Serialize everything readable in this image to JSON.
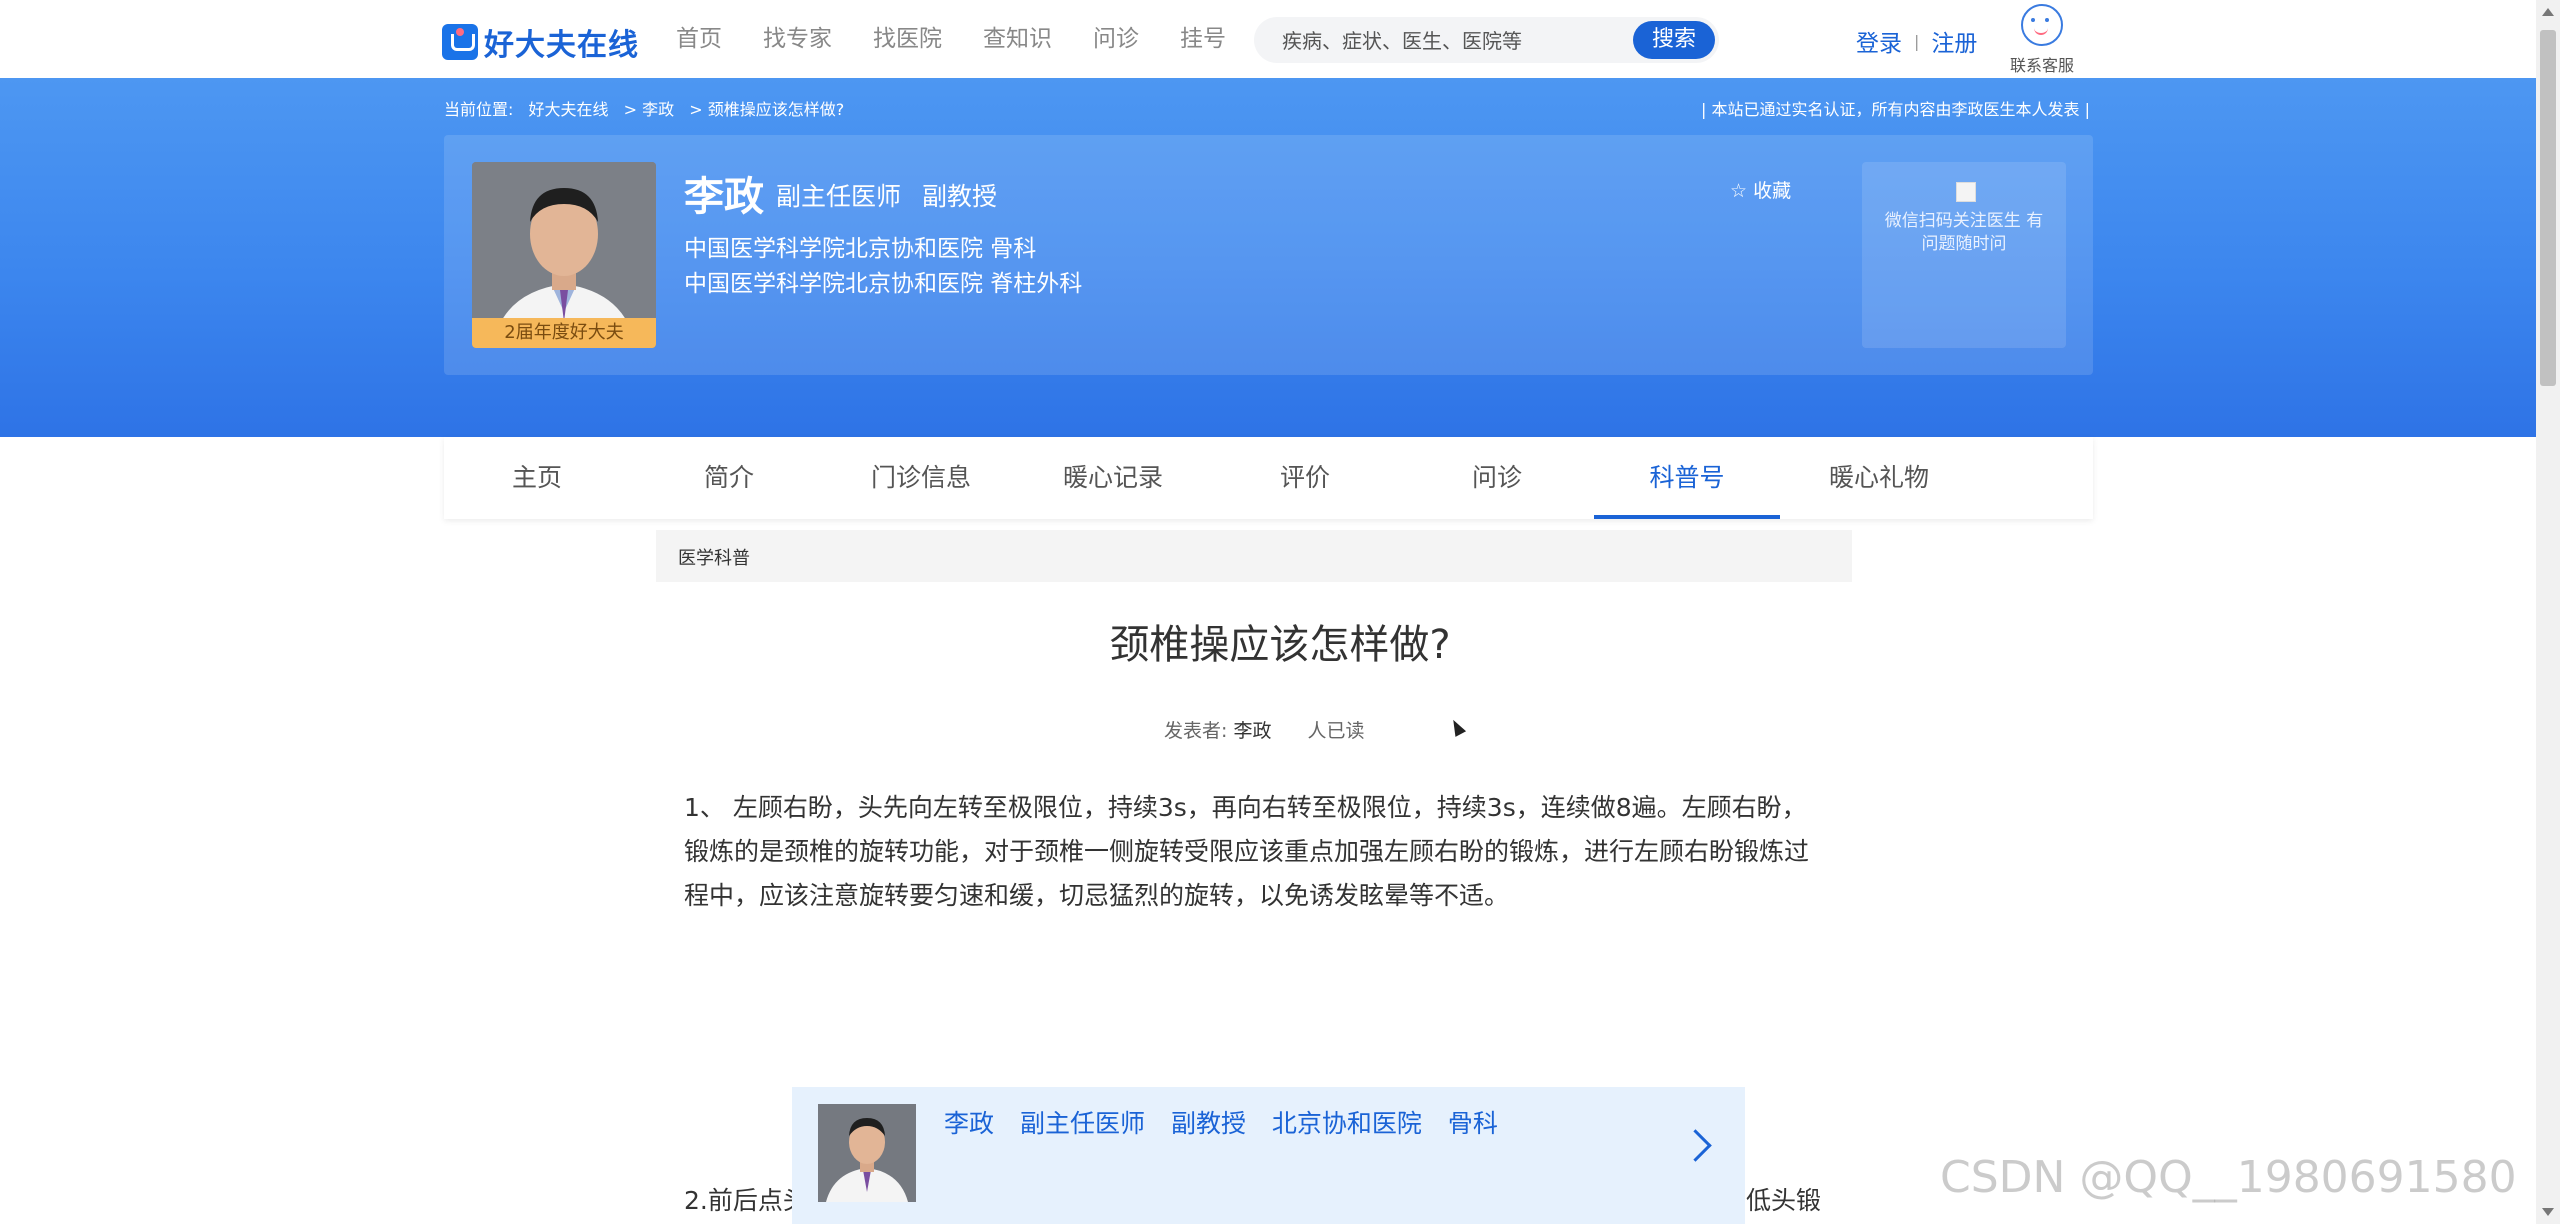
{
  "header": {
    "logo_text": "好大夫在线",
    "nav": [
      "首页",
      "找专家",
      "找医院",
      "查知识",
      "问诊",
      "挂号"
    ],
    "search_placeholder": "疾病、症状、医生、医院等",
    "search_button": "搜索",
    "login": "登录",
    "separator": "|",
    "register": "注册",
    "service_label": "联系客服"
  },
  "banner": {
    "crumb_label": "当前位置:",
    "crumbs": [
      "好大夫在线",
      "> 李政",
      "> 颈椎操应该怎样做?"
    ],
    "verify_text": "|   本站已通过实名认证，所有内容由李政医生本人发表   |",
    "doctor_name": "李政",
    "doctor_title": "副主任医师",
    "doctor_rank": "副教授",
    "hospital_line1": "中国医学科学院北京协和医院   骨科",
    "hospital_line2": "中国医学科学院北京协和医院   脊柱外科",
    "badge": "2届年度好大夫",
    "collect": "☆ 收藏",
    "qr_text": "微信扫码关注医生 有问题随时问"
  },
  "tabs": [
    "主页",
    "简介",
    "门诊信息",
    "暖心记录",
    "评价",
    "问诊",
    "科普号",
    "暖心礼物"
  ],
  "active_tab": "科普号",
  "article": {
    "section": "医学科普",
    "title": "颈椎操应该怎样做?",
    "author_label": "发表者:",
    "author": "李政",
    "reads": "人已读",
    "para1": "1、 左顾右盼，头先向左转至极限位，持续3s，再向右转至极限位，持续3s，连续做8遍。左顾右盼，锻炼的是颈椎的旋转功能，对于颈椎一侧旋转受限应该重点加强左顾右盼的锻炼，进行左顾右盼锻炼过程中，应该注意旋转要匀速和缓，切忌猛烈的旋转，以免诱发眩晕等不适。",
    "para2_start": "2.前后点头",
    "para2_end": "低头锻"
  },
  "float_bar": {
    "name": "李政",
    "title": "副主任医师",
    "rank": "副教授",
    "hospital": "北京协和医院",
    "dept": "骨科"
  },
  "watermark": "CSDN @QQ__1980691580",
  "colors": {
    "brand": "#1a63d6",
    "banner": "#3c86ee",
    "badge": "#f6b85a"
  }
}
